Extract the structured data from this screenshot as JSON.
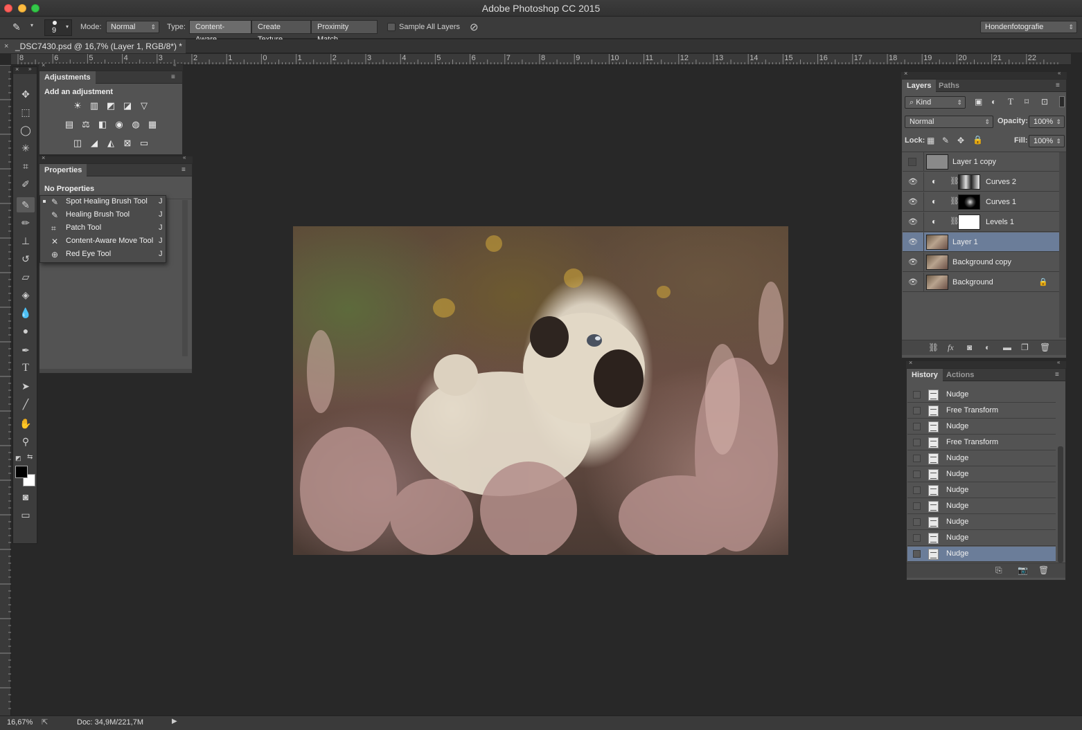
{
  "app": {
    "title": "Adobe Photoshop CC 2015"
  },
  "options": {
    "brush_size": "9",
    "mode_label": "Mode:",
    "mode_value": "Normal",
    "type_label": "Type:",
    "type_options": [
      "Content-Aware",
      "Create Texture",
      "Proximity Match"
    ],
    "sample_all_layers": "Sample All Layers",
    "workspace": "Hondenfotografie"
  },
  "document": {
    "tab_title": "_DSC7430.psd @ 16,7% (Layer 1, RGB/8*) *"
  },
  "ruler": {
    "top_labels": [
      "8",
      "6",
      "4",
      "2",
      "0",
      "2",
      "4",
      "6",
      "8",
      "10",
      "12",
      "14",
      "16",
      "18",
      "20",
      "22",
      "4",
      "6",
      "8",
      "10",
      "12",
      "14",
      "16",
      "18",
      "20",
      "22"
    ],
    "top_labels_display": [
      "8",
      "6",
      "5",
      "4",
      "3",
      "2",
      "1",
      "0",
      "1",
      "2",
      "3",
      "4",
      "5",
      "6",
      "7",
      "8",
      "9",
      "10",
      "11",
      "12",
      "13",
      "14",
      "15",
      "16",
      "17",
      "18",
      "19",
      "20",
      "21",
      "22"
    ]
  },
  "adjustments": {
    "tab": "Adjustments",
    "heading": "Add an adjustment",
    "row1": [
      "☀",
      "▥",
      "◩",
      "◪",
      "▽"
    ],
    "row2": [
      "▤",
      "⚖",
      "◧",
      "◉",
      "◍",
      "▦"
    ],
    "row3": [
      "◫",
      "◢",
      "◭",
      "⊠",
      "▭"
    ]
  },
  "properties": {
    "tab": "Properties",
    "status": "No Properties"
  },
  "flyout": {
    "items": [
      {
        "label": "Spot Healing Brush Tool",
        "key": "J",
        "icon": "spot-healing-brush-icon",
        "selected": true
      },
      {
        "label": "Healing Brush Tool",
        "key": "J",
        "icon": "healing-brush-icon",
        "selected": false
      },
      {
        "label": "Patch Tool",
        "key": "J",
        "icon": "patch-icon",
        "selected": false
      },
      {
        "label": "Content-Aware Move Tool",
        "key": "J",
        "icon": "content-aware-move-icon",
        "selected": false
      },
      {
        "label": "Red Eye Tool",
        "key": "J",
        "icon": "red-eye-icon",
        "selected": false
      }
    ]
  },
  "layers": {
    "tabs": [
      "Layers",
      "Paths"
    ],
    "filter": "Kind",
    "blend_mode": "Normal",
    "opacity_label": "Opacity:",
    "opacity": "100%",
    "lock_label": "Lock:",
    "fill_label": "Fill:",
    "fill": "100%",
    "items": [
      {
        "name": "Layer 1 copy",
        "visible": false,
        "type": "pixel",
        "selected": false
      },
      {
        "name": "Curves 2",
        "visible": true,
        "type": "adjustment",
        "selected": false
      },
      {
        "name": "Curves 1",
        "visible": true,
        "type": "adjustment",
        "selected": false
      },
      {
        "name": "Levels 1",
        "visible": true,
        "type": "adjustment",
        "selected": false
      },
      {
        "name": "Layer 1",
        "visible": true,
        "type": "pixel",
        "selected": true
      },
      {
        "name": "Background copy",
        "visible": true,
        "type": "pixel",
        "selected": false
      },
      {
        "name": "Background",
        "visible": true,
        "type": "pixel",
        "locked": true,
        "selected": false
      }
    ]
  },
  "history": {
    "tabs": [
      "History",
      "Actions"
    ],
    "items": [
      "Nudge",
      "Free Transform",
      "Nudge",
      "Free Transform",
      "Nudge",
      "Nudge",
      "Nudge",
      "Nudge",
      "Nudge",
      "Nudge",
      "Nudge"
    ],
    "selected_index": 10
  },
  "status": {
    "zoom": "16,67%",
    "doc": "Doc: 34,9M/221,7M"
  },
  "colors": {
    "selection": "#6b7d99",
    "panel": "#535353",
    "canvas_bg": "#282828"
  }
}
